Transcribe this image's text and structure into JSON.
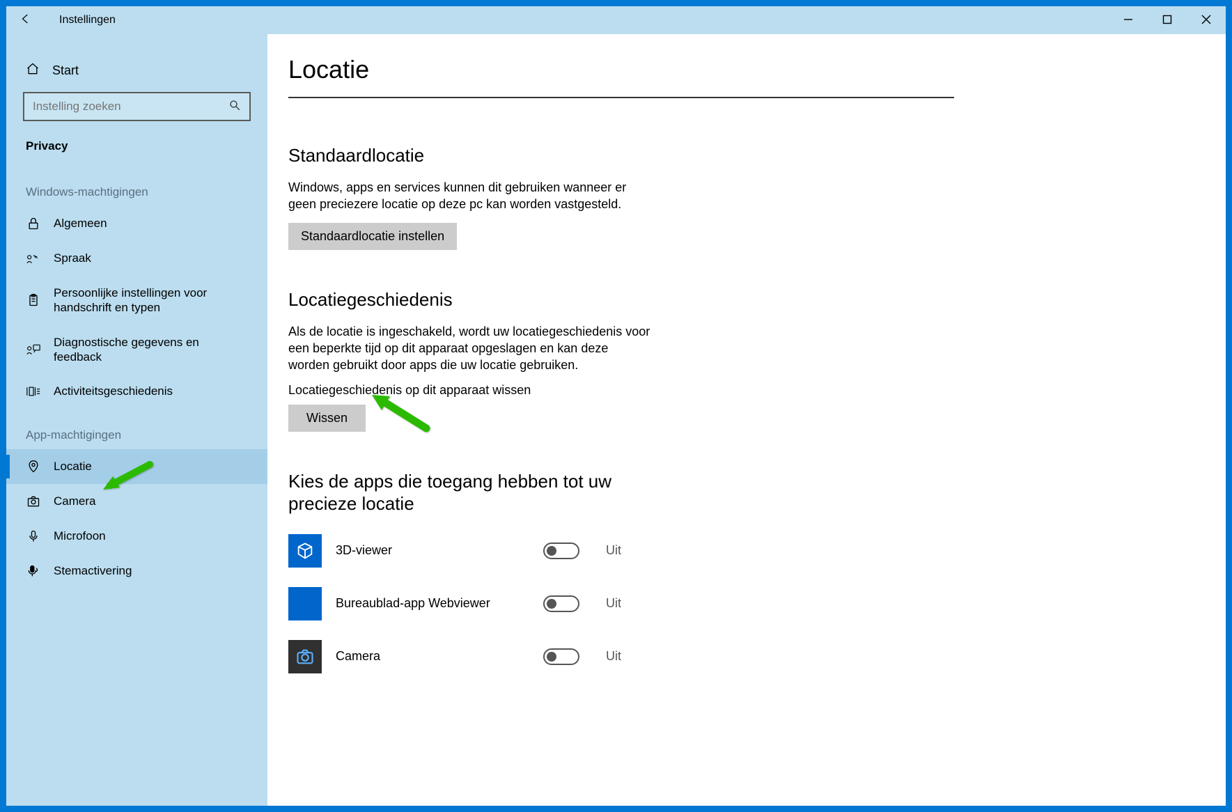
{
  "titlebar": {
    "title": "Instellingen"
  },
  "sidebar": {
    "home": "Start",
    "search_placeholder": "Instelling zoeken",
    "category": "Privacy",
    "group1": "Windows-machtigingen",
    "items1": [
      {
        "label": "Algemeen",
        "icon": "lock"
      },
      {
        "label": "Spraak",
        "icon": "speech"
      },
      {
        "label": "Persoonlijke instellingen voor handschrift en typen",
        "icon": "clipboard"
      },
      {
        "label": "Diagnostische gegevens en feedback",
        "icon": "feedback"
      },
      {
        "label": "Activiteitsgeschiedenis",
        "icon": "history"
      }
    ],
    "group2": "App-machtigingen",
    "items2": [
      {
        "label": "Locatie",
        "icon": "location",
        "selected": true
      },
      {
        "label": "Camera",
        "icon": "camera"
      },
      {
        "label": "Microfoon",
        "icon": "mic"
      },
      {
        "label": "Stemactivering",
        "icon": "voice"
      }
    ]
  },
  "content": {
    "title": "Locatie",
    "sec_default_title": "Standaardlocatie",
    "sec_default_desc": "Windows, apps en services kunnen dit gebruiken wanneer er geen preciezere locatie op deze pc kan worden vastgesteld.",
    "sec_default_btn": "Standaardlocatie instellen",
    "sec_history_title": "Locatiegeschiedenis",
    "sec_history_desc": "Als de locatie is ingeschakeld, wordt uw locatiegeschiedenis voor een beperkte tijd op dit apparaat opgeslagen en kan deze worden gebruikt door apps die uw locatie gebruiken.",
    "sec_history_sublabel": "Locatiegeschiedenis op dit apparaat wissen",
    "sec_history_btn": "Wissen",
    "apps_title": "Kies de apps die toegang hebben tot uw precieze locatie",
    "apps": [
      {
        "name": "3D-viewer",
        "state": "Uit",
        "icon": "3d"
      },
      {
        "name": "Bureaublad-app Webviewer",
        "state": "Uit",
        "icon": "blank"
      },
      {
        "name": "Camera",
        "state": "Uit",
        "icon": "cam"
      }
    ]
  }
}
